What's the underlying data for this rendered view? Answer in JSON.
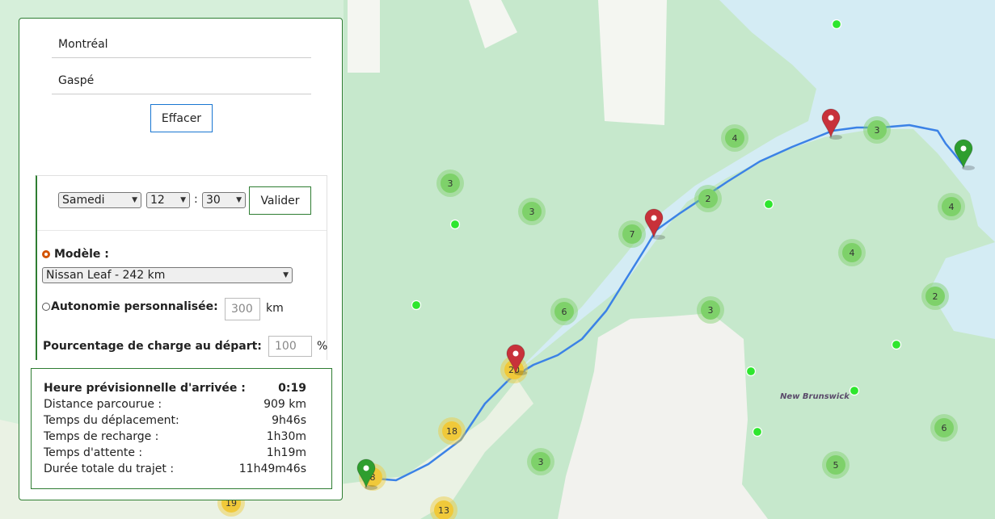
{
  "route": {
    "origin": "Montréal",
    "destination": "Gaspé",
    "clear_label": "Effacer"
  },
  "departure": {
    "day": "Samedi",
    "hour": "12",
    "separator": ":",
    "minute": "30",
    "validate_label": "Valider"
  },
  "vehicle": {
    "model_label": "Modèle :",
    "model_value": "Nissan Leaf - 242 km",
    "custom_label": "Autonomie personnalisée:",
    "custom_placeholder": "300",
    "custom_unit": "km",
    "charge_label": "Pourcentage de charge au départ:",
    "charge_placeholder": "100",
    "charge_unit": "%"
  },
  "results": {
    "rows": [
      {
        "label": "Heure prévisionnelle d'arrivée :",
        "value": "0:19"
      },
      {
        "label": "Distance parcourue :",
        "value": "909 km"
      },
      {
        "label": "Temps du déplacement:",
        "value": "9h46s"
      },
      {
        "label": "Temps de recharge :",
        "value": "1h30m"
      },
      {
        "label": "Temps d'attente :",
        "value": "1h19m"
      },
      {
        "label": "Durée totale du trajet :",
        "value": "11h49m46s"
      }
    ]
  },
  "map": {
    "region_label": "New Brunswick",
    "clusters_green": [
      "3",
      "3",
      "7",
      "6",
      "3",
      "2",
      "3",
      "4",
      "4",
      "4",
      "2",
      "6",
      "5"
    ],
    "clusters_yellow": [
      "20",
      "18",
      "8",
      "13",
      "19"
    ],
    "colors": {
      "land": "#f2f2ee",
      "forest": "#c6e8cc",
      "water": "#d4ecf4",
      "route": "#3b82e6",
      "marker_red": "#c8313a",
      "marker_green": "#2e9e2e",
      "cluster_green": "#7ed16a",
      "cluster_yellow": "#f0c93a",
      "station_dot": "#2ee62e"
    }
  }
}
